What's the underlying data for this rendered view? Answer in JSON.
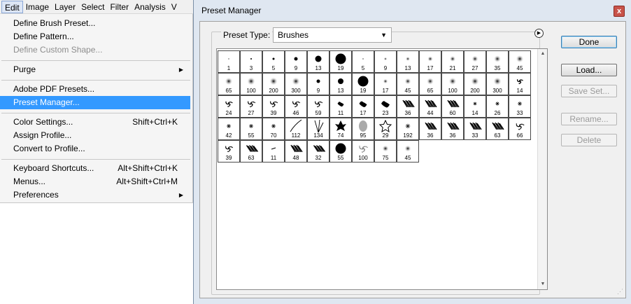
{
  "menubar": {
    "items": [
      "Edit",
      "Image",
      "Layer",
      "Select",
      "Filter",
      "Analysis",
      "V"
    ]
  },
  "edit_menu": {
    "groups": [
      [
        {
          "label": "Define Brush Preset...",
          "shortcut": "",
          "disabled": false
        },
        {
          "label": "Define Pattern...",
          "shortcut": "",
          "disabled": false
        },
        {
          "label": "Define Custom Shape...",
          "shortcut": "",
          "disabled": true
        }
      ],
      [
        {
          "label": "Purge",
          "shortcut": "",
          "submenu": true
        }
      ],
      [
        {
          "label": "Adobe PDF Presets...",
          "shortcut": ""
        },
        {
          "label": "Preset Manager...",
          "shortcut": "",
          "selected": true
        }
      ],
      [
        {
          "label": "Color Settings...",
          "shortcut": "Shift+Ctrl+K"
        },
        {
          "label": "Assign Profile...",
          "shortcut": ""
        },
        {
          "label": "Convert to Profile...",
          "shortcut": ""
        }
      ],
      [
        {
          "label": "Keyboard Shortcuts...",
          "shortcut": "Alt+Shift+Ctrl+K"
        },
        {
          "label": "Menus...",
          "shortcut": "Alt+Shift+Ctrl+M"
        },
        {
          "label": "Preferences",
          "shortcut": "",
          "submenu": true
        }
      ]
    ]
  },
  "dialog": {
    "title": "Preset Manager",
    "close_label": "x",
    "preset_type_label": "Preset Type:",
    "preset_type_value": "Brushes",
    "buttons": {
      "done": "Done",
      "load": "Load...",
      "save_set": "Save Set...",
      "rename": "Rename...",
      "delete": "Delete"
    }
  },
  "brushes": [
    {
      "n": "1",
      "k": "hard",
      "s": 1
    },
    {
      "n": "3",
      "k": "hard",
      "s": 2
    },
    {
      "n": "5",
      "k": "hard",
      "s": 3
    },
    {
      "n": "9",
      "k": "hard",
      "s": 5
    },
    {
      "n": "13",
      "k": "hard",
      "s": 9
    },
    {
      "n": "19",
      "k": "hard",
      "s": 15
    },
    {
      "n": "5",
      "k": "soft",
      "s": 4
    },
    {
      "n": "9",
      "k": "soft",
      "s": 6
    },
    {
      "n": "13",
      "k": "soft",
      "s": 8
    },
    {
      "n": "17",
      "k": "soft",
      "s": 10
    },
    {
      "n": "21",
      "k": "soft",
      "s": 11
    },
    {
      "n": "27",
      "k": "soft",
      "s": 12
    },
    {
      "n": "35",
      "k": "soft",
      "s": 13
    },
    {
      "n": "45",
      "k": "soft",
      "s": 14
    },
    {
      "n": "65",
      "k": "soft",
      "s": 14
    },
    {
      "n": "100",
      "k": "soft",
      "s": 15
    },
    {
      "n": "200",
      "k": "soft",
      "s": 15
    },
    {
      "n": "300",
      "k": "soft",
      "s": 15
    },
    {
      "n": "9",
      "k": "hard",
      "s": 5
    },
    {
      "n": "13",
      "k": "hard",
      "s": 8
    },
    {
      "n": "19",
      "k": "hard",
      "s": 15
    },
    {
      "n": "17",
      "k": "soft",
      "s": 9
    },
    {
      "n": "45",
      "k": "soft",
      "s": 12
    },
    {
      "n": "65",
      "k": "soft",
      "s": 13
    },
    {
      "n": "100",
      "k": "soft",
      "s": 14
    },
    {
      "n": "200",
      "k": "soft",
      "s": 15
    },
    {
      "n": "300",
      "k": "soft",
      "s": 15
    },
    {
      "n": "14",
      "k": "splat",
      "s": 10
    },
    {
      "n": "24",
      "k": "splat",
      "s": 12
    },
    {
      "n": "27",
      "k": "splat",
      "s": 13
    },
    {
      "n": "39",
      "k": "splat",
      "s": 13
    },
    {
      "n": "46",
      "k": "splat",
      "s": 13
    },
    {
      "n": "59",
      "k": "splat",
      "s": 13
    },
    {
      "n": "11",
      "k": "blob",
      "s": 9
    },
    {
      "n": "17",
      "k": "blob",
      "s": 11
    },
    {
      "n": "23",
      "k": "blob",
      "s": 12
    },
    {
      "n": "36",
      "k": "texture",
      "s": 14
    },
    {
      "n": "44",
      "k": "texture",
      "s": 14
    },
    {
      "n": "60",
      "k": "texture",
      "s": 14
    },
    {
      "n": "14",
      "k": "star",
      "s": 8
    },
    {
      "n": "26",
      "k": "star",
      "s": 9
    },
    {
      "n": "33",
      "k": "star",
      "s": 10
    },
    {
      "n": "42",
      "k": "star",
      "s": 10
    },
    {
      "n": "55",
      "k": "star",
      "s": 10
    },
    {
      "n": "70",
      "k": "star",
      "s": 10
    },
    {
      "n": "112",
      "k": "stroke",
      "s": 14
    },
    {
      "n": "134",
      "k": "grass",
      "s": 14
    },
    {
      "n": "74",
      "k": "leaf",
      "s": 13
    },
    {
      "n": "95",
      "k": "leafsoft",
      "s": 13
    },
    {
      "n": "29",
      "k": "outline-star",
      "s": 14
    },
    {
      "n": "192",
      "k": "star",
      "s": 11
    },
    {
      "n": "36",
      "k": "texture",
      "s": 14
    },
    {
      "n": "36",
      "k": "texture",
      "s": 14
    },
    {
      "n": "33",
      "k": "texture",
      "s": 14
    },
    {
      "n": "63",
      "k": "texture",
      "s": 14
    },
    {
      "n": "66",
      "k": "splat",
      "s": 14
    },
    {
      "n": "39",
      "k": "splat",
      "s": 13
    },
    {
      "n": "63",
      "k": "texture",
      "s": 13
    },
    {
      "n": "11",
      "k": "dash",
      "s": 8
    },
    {
      "n": "48",
      "k": "texture",
      "s": 14
    },
    {
      "n": "32",
      "k": "texture",
      "s": 13
    },
    {
      "n": "55",
      "k": "hard",
      "s": 15
    },
    {
      "n": "100",
      "k": "noise",
      "s": 15
    },
    {
      "n": "75",
      "k": "soft",
      "s": 12
    },
    {
      "n": "45",
      "k": "soft",
      "s": 12
    }
  ]
}
